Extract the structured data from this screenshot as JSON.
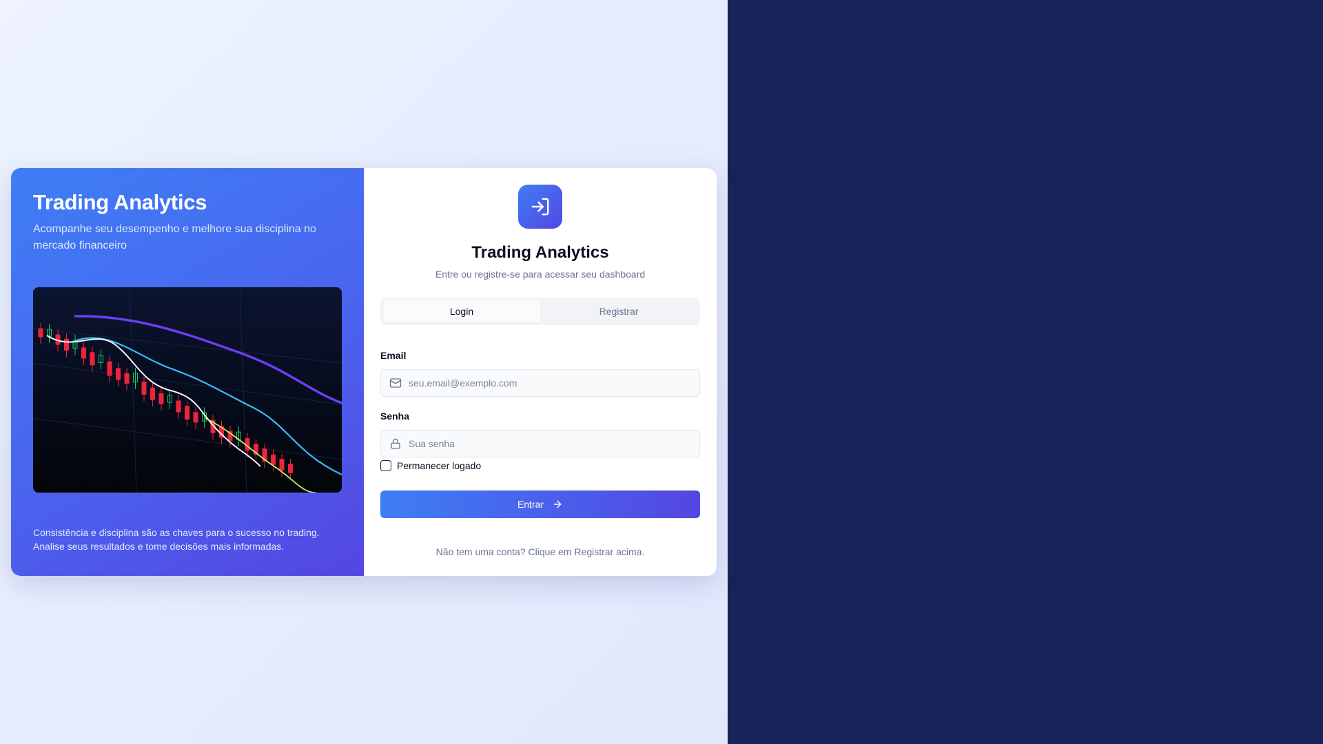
{
  "hero": {
    "title": "Trading Analytics",
    "subtitle": "Acompanhe seu desempenho e melhore sua disciplina no mercado financeiro",
    "footer_line1": "Consistência e disciplina são as chaves para o sucesso no trading.",
    "footer_line2": "Analise seus resultados e tome decisões mais informadas.",
    "image_icon": "candlestick-chart-photo"
  },
  "form": {
    "logo_icon": "sign-in-icon",
    "title": "Trading Analytics",
    "subtitle": "Entre ou registre-se para acessar seu dashboard",
    "tabs": [
      {
        "label": "Login",
        "active": true
      },
      {
        "label": "Registrar",
        "active": false
      }
    ],
    "email": {
      "label": "Email",
      "placeholder": "seu.email@exemplo.com",
      "value": "",
      "icon": "mail-icon"
    },
    "password": {
      "label": "Senha",
      "placeholder": "Sua senha",
      "value": "",
      "icon": "lock-icon"
    },
    "remember": {
      "label": "Permanecer logado",
      "checked": false
    },
    "submit": {
      "label": "Entrar",
      "icon": "arrow-right-icon"
    },
    "footnote": "Não tem uma conta? Clique em Registrar acima."
  },
  "colors": {
    "accent_start": "#3e7ef5",
    "accent_end": "#5446e2",
    "dark_side": "#17245a",
    "candle_up": "#22c55e",
    "candle_down": "#ef233c"
  }
}
